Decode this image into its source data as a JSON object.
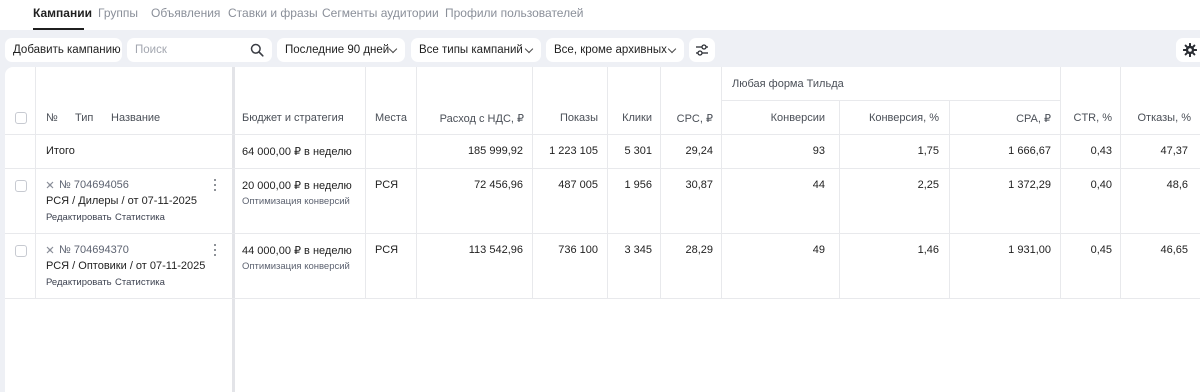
{
  "tabs": [
    {
      "label": "Кампании",
      "active": true
    },
    {
      "label": "Группы"
    },
    {
      "label": "Объявления"
    },
    {
      "label": "Ставки и фразы"
    },
    {
      "label": "Сегменты аудитории"
    },
    {
      "label": "Профили пользователей"
    }
  ],
  "toolbar": {
    "add_campaign": "Добавить кампанию",
    "search_placeholder": "Поиск",
    "period": "Последние 90 дней",
    "campaign_types": "Все типы кампаний",
    "status_filter": "Все, кроме архивных"
  },
  "table": {
    "group_header": "Любая форма Тильда",
    "columns": {
      "num": "№",
      "type": "Тип",
      "name": "Название",
      "budget": "Бюджет и стратегия",
      "places": "Места",
      "spend": "Расход с НДС, ₽",
      "impressions": "Показы",
      "clicks": "Клики",
      "cpc": "CPC, ₽",
      "conversions": "Конверсии",
      "conv_rate": "Конверсия, %",
      "cpa": "CPA, ₽",
      "ctr": "CTR, %",
      "bounces": "Отказы, %"
    },
    "total": {
      "label": "Итого",
      "budget": "64 000,00 ₽ в неделю",
      "spend": "185 999,92",
      "impressions": "1 223 105",
      "clicks": "5 301",
      "cpc": "29,24",
      "conversions": "93",
      "conv_rate": "1,75",
      "cpa": "1 666,67",
      "ctr": "0,43",
      "bounces": "47,37"
    },
    "rows": [
      {
        "id": "№ 704694056",
        "name": "РСЯ / Дилеры / от 07-11-2025",
        "edit": "Редактировать",
        "stats": "Статистика",
        "budget": "20 000,00 ₽ в неделю",
        "strategy": "Оптимизация конверсий",
        "places": "РСЯ",
        "spend": "72 456,96",
        "impressions": "487 005",
        "clicks": "1 956",
        "cpc": "30,87",
        "conversions": "44",
        "conv_rate": "2,25",
        "cpa": "1 372,29",
        "ctr": "0,40",
        "bounces": "48,6"
      },
      {
        "id": "№ 704694370",
        "name": "РСЯ / Оптовики / от 07-11-2025",
        "edit": "Редактировать",
        "stats": "Статистика",
        "budget": "44 000,00 ₽ в неделю",
        "strategy": "Оптимизация конверсий",
        "places": "РСЯ",
        "spend": "113 542,96",
        "impressions": "736 100",
        "clicks": "3 345",
        "cpc": "28,29",
        "conversions": "49",
        "conv_rate": "1,46",
        "cpa": "1 931,00",
        "ctr": "0,45",
        "bounces": "46,65"
      }
    ]
  }
}
